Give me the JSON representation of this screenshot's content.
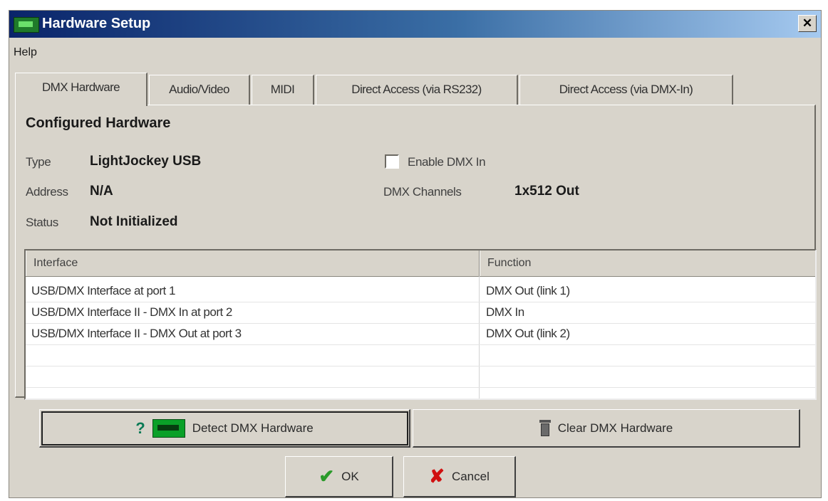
{
  "window": {
    "title": "Hardware Setup",
    "close_glyph": "✕"
  },
  "menu": {
    "items": [
      "Help"
    ]
  },
  "tabs": [
    {
      "label": "DMX Hardware",
      "active": true
    },
    {
      "label": "Audio/Video",
      "active": false
    },
    {
      "label": "MIDI",
      "active": false
    },
    {
      "label": "Direct Access (via RS232)",
      "active": false
    },
    {
      "label": "Direct Access (via DMX-In)",
      "active": false
    }
  ],
  "configured": {
    "title": "Configured Hardware",
    "type_label": "Type",
    "type_value": "LightJockey USB",
    "address_label": "Address",
    "address_value": "N/A",
    "status_label": "Status",
    "status_value": "Not Initialized",
    "enable_dmx_in_label": "Enable DMX In",
    "enable_dmx_in_checked": false,
    "dmx_channels_label": "DMX Channels",
    "dmx_channels_value": "1x512 Out"
  },
  "interfaces": {
    "columns": [
      "Interface",
      "Function"
    ],
    "rows": [
      {
        "interface": "USB/DMX Interface at port 1",
        "function": "DMX Out (link 1)"
      },
      {
        "interface": "USB/DMX Interface II - DMX In at port 2",
        "function": "DMX In"
      },
      {
        "interface": "USB/DMX Interface II - DMX Out at port 3",
        "function": "DMX Out (link 2)"
      }
    ]
  },
  "buttons": {
    "detect": "Detect DMX Hardware",
    "clear": "Clear DMX Hardware",
    "ok": "OK",
    "cancel": "Cancel"
  },
  "icons": {
    "detect_help_glyph": "?",
    "ok_glyph": "✔",
    "cancel_glyph": "✘"
  },
  "colors": {
    "window_bg": "#d8d4cb",
    "titlebar_start": "#0a246a",
    "titlebar_end": "#a6caf0",
    "ok_green": "#2a9a2a",
    "cancel_red": "#d01010"
  }
}
